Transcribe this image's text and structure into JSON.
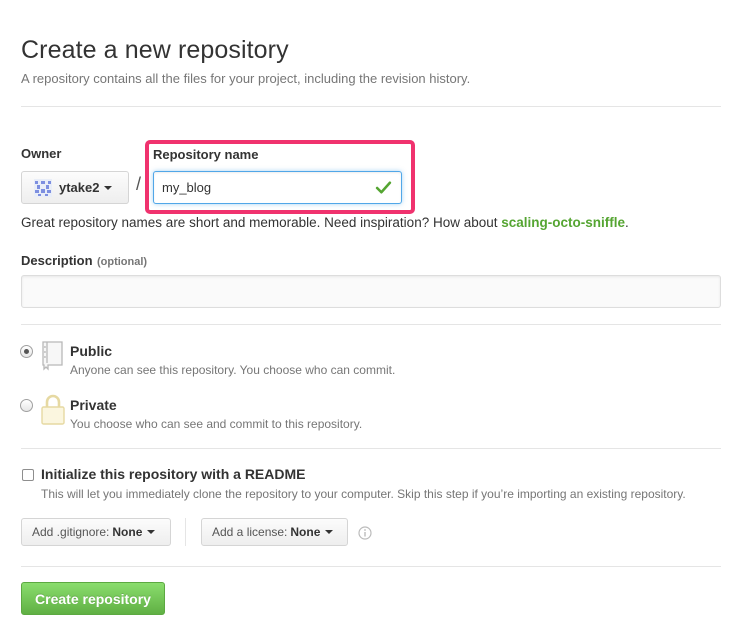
{
  "header": {
    "title": "Create a new repository",
    "subtitle": "A repository contains all the files for your project, including the revision history."
  },
  "owner": {
    "label": "Owner",
    "selected": "ytake2",
    "separator": "/"
  },
  "repo_name": {
    "label": "Repository name",
    "value": "my_blog",
    "valid_icon": "check-icon",
    "valid_color": "#55a532"
  },
  "name_hint": {
    "text": "Great repository names are short and memorable. Need inspiration? How about",
    "suggestion": "scaling-octo-sniffle",
    "suffix": "."
  },
  "description": {
    "label": "Description",
    "optional": "(optional)",
    "value": "",
    "placeholder": ""
  },
  "visibility": {
    "selected": "Public",
    "options": [
      {
        "title": "Public",
        "note": "Anyone can see this repository. You choose who can commit.",
        "icon": "repo-book-icon"
      },
      {
        "title": "Private",
        "note": "You choose who can see and commit to this repository.",
        "icon": "lock-icon"
      }
    ]
  },
  "init": {
    "label": "Initialize this repository with a README",
    "note": "This will let you immediately clone the repository to your computer. Skip this step if you’re importing an existing repository.",
    "checked": false
  },
  "gitignore": {
    "label": "Add .gitignore:",
    "value": "None"
  },
  "license": {
    "label": "Add a license:",
    "value": "None",
    "info_icon": "info-icon"
  },
  "submit": {
    "label": "Create repository"
  },
  "colors": {
    "highlight": "#f0326e",
    "focus_border": "#51a7e8",
    "primary_button": "#60b044"
  }
}
